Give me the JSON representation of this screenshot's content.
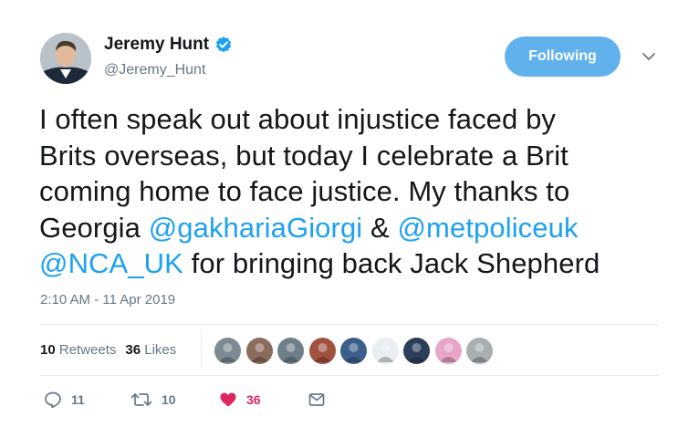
{
  "author": {
    "name": "Jeremy Hunt",
    "handle": "@Jeremy_Hunt",
    "verified": true
  },
  "follow_button": {
    "label": "Following"
  },
  "tweet": {
    "line1": "I often speak out about injustice faced by",
    "line2": "Brits overseas, but today I celebrate a Brit",
    "line3": "coming home to face justice. My thanks to",
    "line4_prefix": "Georgia ",
    "mention1": "@gakhariaGiorgi",
    "line4_mid": " & ",
    "mention2": "@metpoliceuk",
    "mention3": "@NCA_UK",
    "line5_suffix": " for bringing back Jack Shepherd",
    "timestamp": "2:10 AM - 11 Apr 2019"
  },
  "stats": {
    "retweets_count": "10",
    "retweets_label": "Retweets",
    "likes_count": "36",
    "likes_label": "Likes"
  },
  "likers": [
    {
      "color": "#7b8a93"
    },
    {
      "color": "#8a6b5c"
    },
    {
      "color": "#6e7f89"
    },
    {
      "color": "#a0523f"
    },
    {
      "color": "#3b5f8a"
    },
    {
      "color": "#e9eef1"
    },
    {
      "color": "#2c3e5a"
    },
    {
      "color": "#e7a6c8"
    },
    {
      "color": "#a9aeb3"
    }
  ],
  "actions": {
    "reply_count": "11",
    "retweet_count": "10",
    "like_count": "36"
  },
  "colors": {
    "link": "#1da1f2",
    "follow_bg": "#61b2ec",
    "like": "#e0245e",
    "secondary": "#657786"
  }
}
